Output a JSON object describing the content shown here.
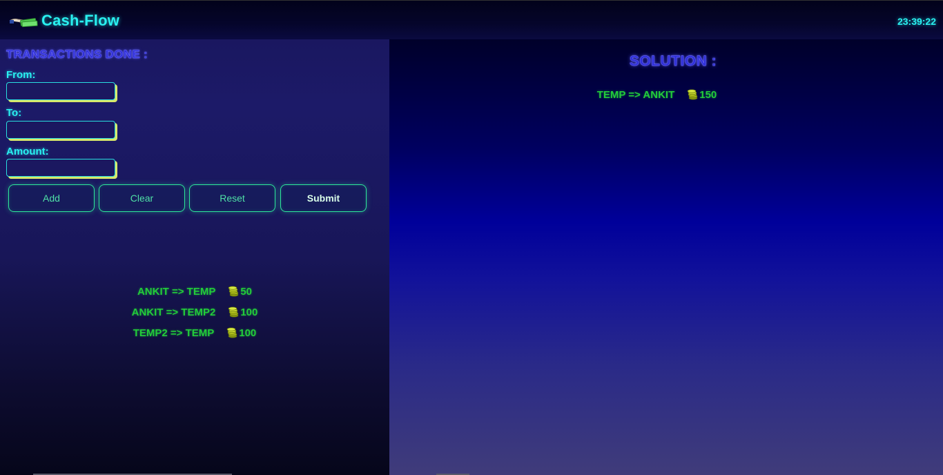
{
  "header": {
    "title": "Cash-Flow",
    "clock": "23:39:22",
    "logo_icon": "money-hand-icon"
  },
  "form": {
    "section_title": "TRANSACTIONS DONE :",
    "from_label": "From:",
    "from_value": "",
    "to_label": "To:",
    "to_value": "",
    "amount_label": "Amount:",
    "amount_value": "",
    "buttons": {
      "add": "Add",
      "clear": "Clear",
      "reset": "Reset",
      "submit": "Submit"
    }
  },
  "transactions": [
    {
      "route": "ANKIT => TEMP",
      "amount": "50"
    },
    {
      "route": "ANKIT => TEMP2",
      "amount": "100"
    },
    {
      "route": "TEMP2 => TEMP",
      "amount": "100"
    }
  ],
  "solution": {
    "title": "SOLUTION :",
    "items": [
      {
        "route": "TEMP => ANKIT",
        "amount": "150"
      }
    ]
  },
  "colors": {
    "accent_cyan": "#29f0f0",
    "title_blue": "#2f2fd8",
    "tx_green": "#22cc3a",
    "button_green": "#2ee89a",
    "input_shadow_yellow": "#d8e86a"
  }
}
